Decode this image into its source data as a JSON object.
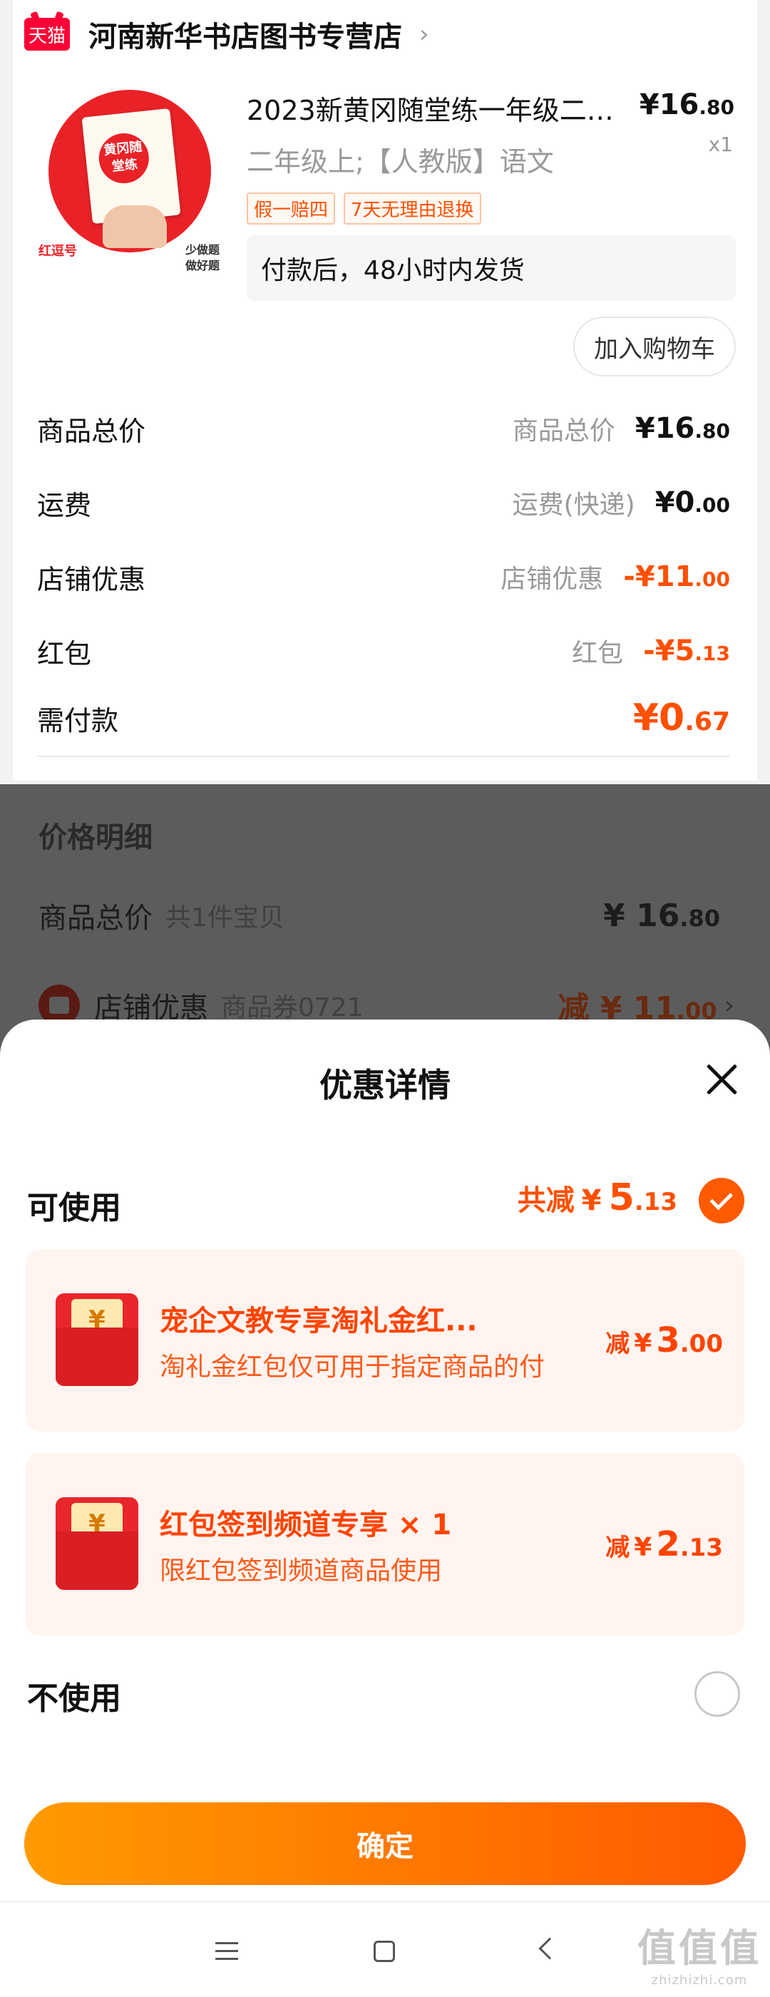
{
  "shop": {
    "logo_text": "天猫",
    "name": "河南新华书店图书专营店",
    "chevron": "›"
  },
  "product": {
    "image_text": "黄冈随堂练",
    "image_brand": "红逗号",
    "image_slogan": "少做题\n做好题",
    "title": "2023新黄冈随堂练一年级二…",
    "sku": "二年级上;【人教版】语文",
    "price_int": "¥16",
    "price_dec": ".80",
    "qty": "x1",
    "tags": [
      "假一赔四",
      "7天无理由退换"
    ],
    "shipping_note": "付款后，48小时内发货",
    "add_cart": "加入购物车"
  },
  "fees": [
    {
      "label": "商品总价",
      "sub": "商品总价",
      "int": "¥16",
      "dec": ".80"
    },
    {
      "label": "运费",
      "sub": "运费(快递)",
      "int": "¥0",
      "dec": ".00"
    },
    {
      "label": "店铺优惠",
      "sub": "店铺优惠",
      "int": "-¥11",
      "dec": ".00"
    },
    {
      "label": "红包",
      "sub": "红包",
      "int": "-¥5",
      "dec": ".13"
    }
  ],
  "payable": {
    "label": "需付款",
    "int": "¥0",
    "dec": ".67"
  },
  "price_detail": {
    "title": "价格明细",
    "row1": {
      "label": "商品总价",
      "sub": "共1件宝贝",
      "int": "¥ 16",
      "dec": ".80"
    },
    "row2": {
      "label": "店铺优惠",
      "sub": "商品券0721",
      "int": "减 ¥ 11",
      "dec": ".00",
      "chevron": "›"
    }
  },
  "sheet": {
    "title": "优惠详情",
    "available_label": "可使用",
    "total_off": {
      "prefix": "共减",
      "currency": "¥",
      "int": "5",
      "dec": ".13"
    },
    "coupons": [
      {
        "icon": "¥",
        "title": "宠企文教专享淘礼金红...",
        "desc": "淘礼金红包仅可用于指定商品的付",
        "prefix": "减",
        "currency": "¥",
        "int": "3",
        "dec": ".00"
      },
      {
        "icon": "¥",
        "title": "红包签到频道专享 × 1",
        "desc": "限红包签到频道商品使用",
        "prefix": "减",
        "currency": "¥",
        "int": "2",
        "dec": ".13"
      }
    ],
    "not_use_label": "不使用",
    "confirm": "确定"
  },
  "watermark": {
    "main": "值值值",
    "sub": "zhizhizhi.com"
  },
  "colors": {
    "accent": "#ff5000",
    "tmall_red": "#ff0036",
    "coupon_bg": "#fff4f0"
  }
}
